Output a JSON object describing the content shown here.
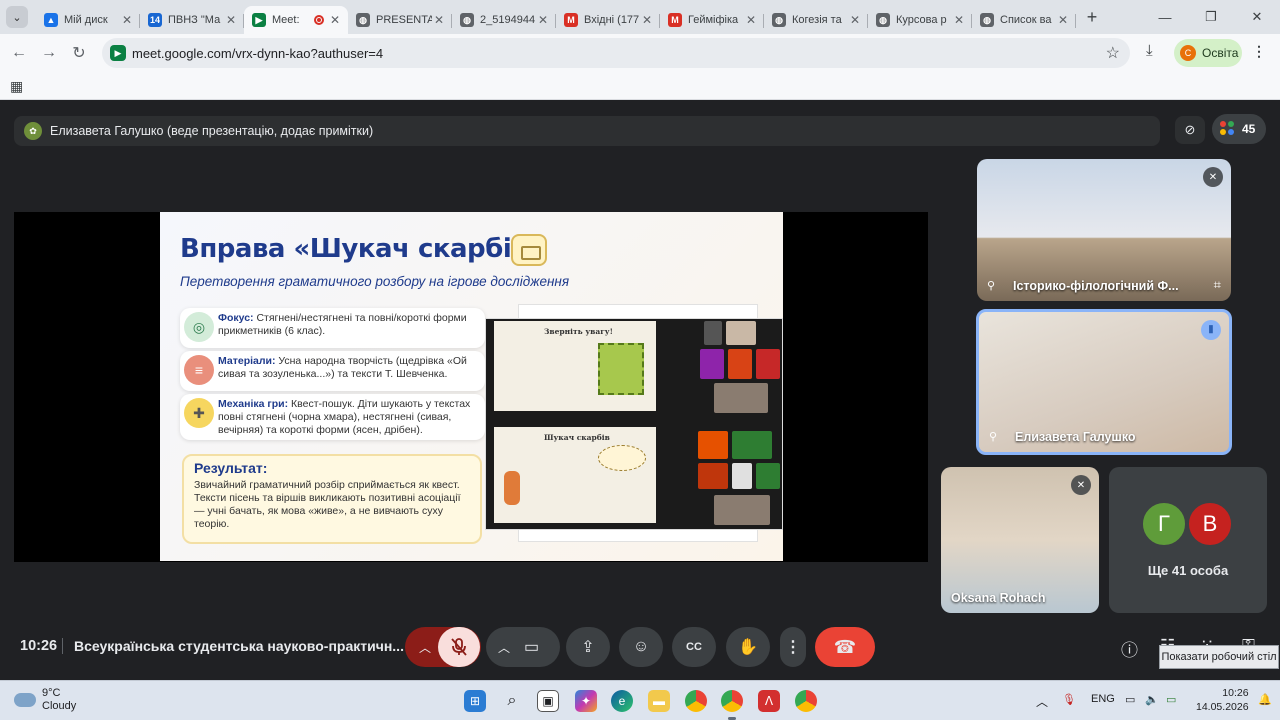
{
  "browser": {
    "tabs": [
      {
        "label": "Мій диск",
        "favicon": "google-drive-icon",
        "color": "#1a73e8",
        "glyph": "▲"
      },
      {
        "label": "ПВНЗ \"Ма",
        "favicon": "calendar-icon",
        "color": "#1967d2",
        "glyph": "14"
      },
      {
        "label": "Meet:",
        "favicon": "google-meet-icon",
        "color": "#0b8043",
        "glyph": "▶",
        "active": true
      },
      {
        "label": "PRESENTA",
        "favicon": "globe-icon",
        "color": "#5f6368",
        "glyph": "◍"
      },
      {
        "label": "2_5194944",
        "favicon": "globe-icon",
        "color": "#5f6368",
        "glyph": "◍"
      },
      {
        "label": "Вхідні (177",
        "favicon": "gmail-icon",
        "color": "#d93025",
        "glyph": "M"
      },
      {
        "label": "Гейміфіка",
        "favicon": "gmail-icon",
        "color": "#d93025",
        "glyph": "M"
      },
      {
        "label": "Когезія та",
        "favicon": "globe-icon",
        "color": "#5f6368",
        "glyph": "◍"
      },
      {
        "label": "Курсова р",
        "favicon": "globe-icon",
        "color": "#5f6368",
        "glyph": "◍"
      },
      {
        "label": "Список ва",
        "favicon": "globe-icon",
        "color": "#5f6368",
        "glyph": "◍"
      }
    ],
    "url": "meet.google.com/vrx-dynn-kao?authuser=4",
    "profile_label": "Освіта",
    "profile_initial": "С"
  },
  "meet": {
    "presenter_label": "Елизавета Галушко (веде презентацію, додає примітки)",
    "participant_count": "45",
    "time": "10:26",
    "meeting_title": "Всеукраїнська студентська науково-практичн...",
    "tooltip": "Показати робочий стіл",
    "tiles": {
      "room_name": "Історико-філологічний Ф...",
      "speaker_name": "Елизавета Галушко",
      "participant_name": "Oksana Rohach",
      "avatar_1": "Г",
      "avatar_2": "В",
      "more_label": "Ще 41 особа"
    }
  },
  "slide": {
    "title": "Вправа «Шукач скарбів»",
    "subtitle": "Перетворення граматичного розбору на ігрове дослідження",
    "cards": [
      {
        "heading": "Фокус:",
        "text": " Стягнені/нестягнені та повні/короткі форми прикметників (6 клас)."
      },
      {
        "heading": "Матеріали:",
        "text": " Усна народна творчість (щедрівка «Ой сивая та зозуленька...») та тексти Т. Шевченка."
      },
      {
        "heading": "Механіка гри:",
        "text": " Квест-пошук. Діти шукають у текстах повні стягнені (чорна хмара), нестягнені (сивая, вечірняя) та короткі форми (ясен, дрібен)."
      }
    ],
    "result_heading": "Результат:",
    "result_text": "Звичайний граматичний розбір сприймається як квест. Тексти пісень та віршів викликають позитивні асоціації — учні бачать, як мова «живе», а не вивчають суху теорію.",
    "shot_top_title": "Зверніть увагу!",
    "shot_bottom_title": "Шукач скарбів"
  },
  "taskbar": {
    "temperature": "9°C",
    "weather": "Cloudy",
    "language": "ENG",
    "time": "10:26",
    "date": "14.05.2026"
  }
}
